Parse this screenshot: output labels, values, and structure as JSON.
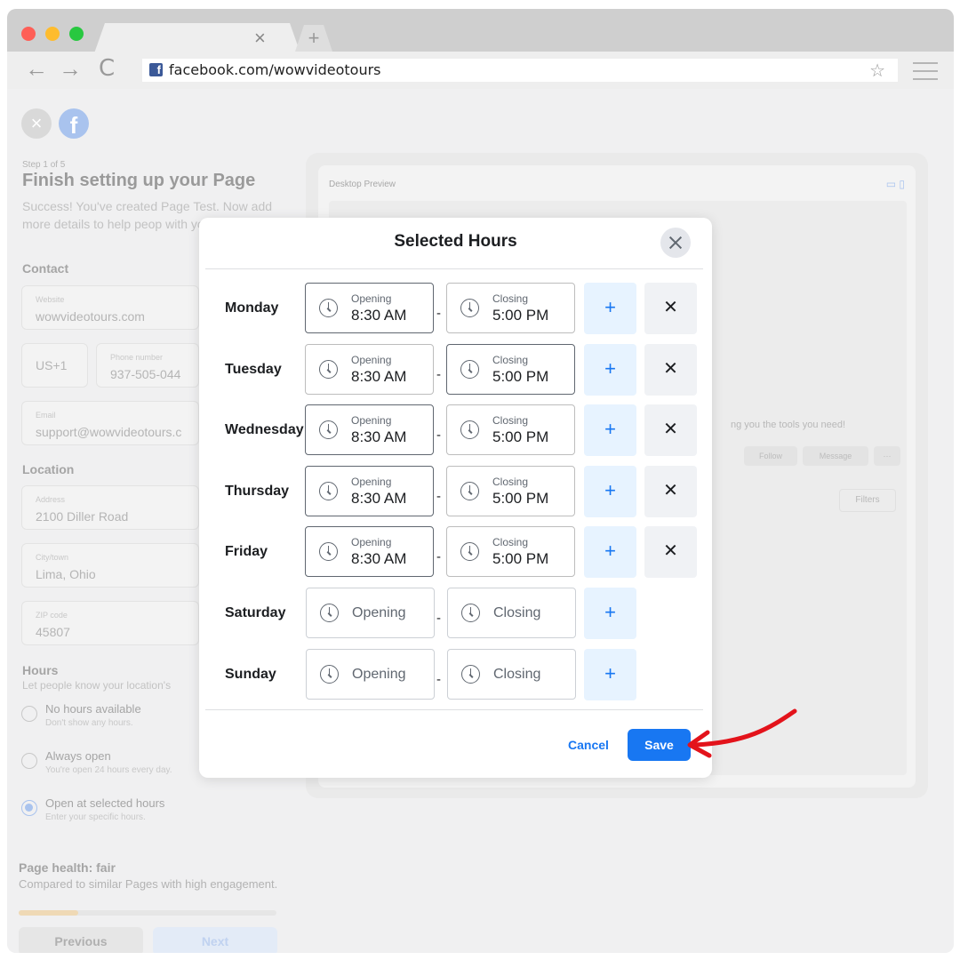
{
  "browser": {
    "url": "facebook.com/wowvideotours",
    "tab_close_glyph": "×",
    "new_tab_glyph": "+",
    "back_glyph": "←",
    "forward_glyph": "→",
    "reload_glyph": "C",
    "favicon_letter": "f",
    "bookmark_glyph": "☆",
    "traffic_lights": [
      "#fe5f57",
      "#febc2e",
      "#28c840"
    ]
  },
  "header": {
    "close_glyph": "×",
    "logo_letter": "f"
  },
  "sidebar": {
    "step": "Step 1 of 5",
    "title": "Finish setting up your Page",
    "description": "Success! You've created Page Test. Now add more details to help peop with you.",
    "contact_heading": "Contact",
    "website_label": "Website",
    "website_value": "wowvideotours.com",
    "country_code": "US+1",
    "phone_label": "Phone number",
    "phone_value": "937-505-044",
    "email_label": "Email",
    "email_value": "support@wowvideotours.c",
    "location_heading": "Location",
    "address_label": "Address",
    "address_value": "2100 Diller Road",
    "city_label": "City/town",
    "city_value": "Lima, Ohio",
    "zip_label": "ZIP code",
    "zip_value": "45807",
    "hours_heading": "Hours",
    "hours_desc": "Let people know your location's",
    "hours_options": [
      {
        "title": "No hours available",
        "sub": "Don't show any hours.",
        "selected": false
      },
      {
        "title": "Always open",
        "sub": "You're open 24 hours every day.",
        "selected": false
      },
      {
        "title": "Open at selected hours",
        "sub": "Enter your specific hours.",
        "selected": true
      }
    ],
    "health_title": "Page health: fair",
    "health_desc": "Compared to similar Pages with high engagement.",
    "health_progress": 0.23,
    "previous_label": "Previous",
    "next_label": "Next"
  },
  "preview": {
    "title": "Desktop Preview",
    "tools_text": "ng you the tools you need!",
    "follow_label": "Follow",
    "message_label": "Message",
    "more_label": "···",
    "filters_label": "Filters"
  },
  "modal": {
    "title": "Selected Hours",
    "opening_label": "Opening",
    "closing_label": "Closing",
    "separator": "-",
    "add_glyph": "+",
    "remove_glyph": "✕",
    "days": [
      {
        "name": "Monday",
        "open": "8:30 AM",
        "close": "5:00 PM"
      },
      {
        "name": "Tuesday",
        "open": "8:30 AM",
        "close": "5:00 PM"
      },
      {
        "name": "Wednesday",
        "open": "8:30 AM",
        "close": "5:00 PM"
      },
      {
        "name": "Thursday",
        "open": "8:30 AM",
        "close": "5:00 PM"
      },
      {
        "name": "Friday",
        "open": "8:30 AM",
        "close": "5:00 PM"
      },
      {
        "name": "Saturday",
        "open": "",
        "close": ""
      },
      {
        "name": "Sunday",
        "open": "",
        "close": ""
      }
    ],
    "cancel_label": "Cancel",
    "save_label": "Save"
  },
  "colors": {
    "accent": "#1877f2",
    "annotation_arrow": "#e3131b"
  }
}
